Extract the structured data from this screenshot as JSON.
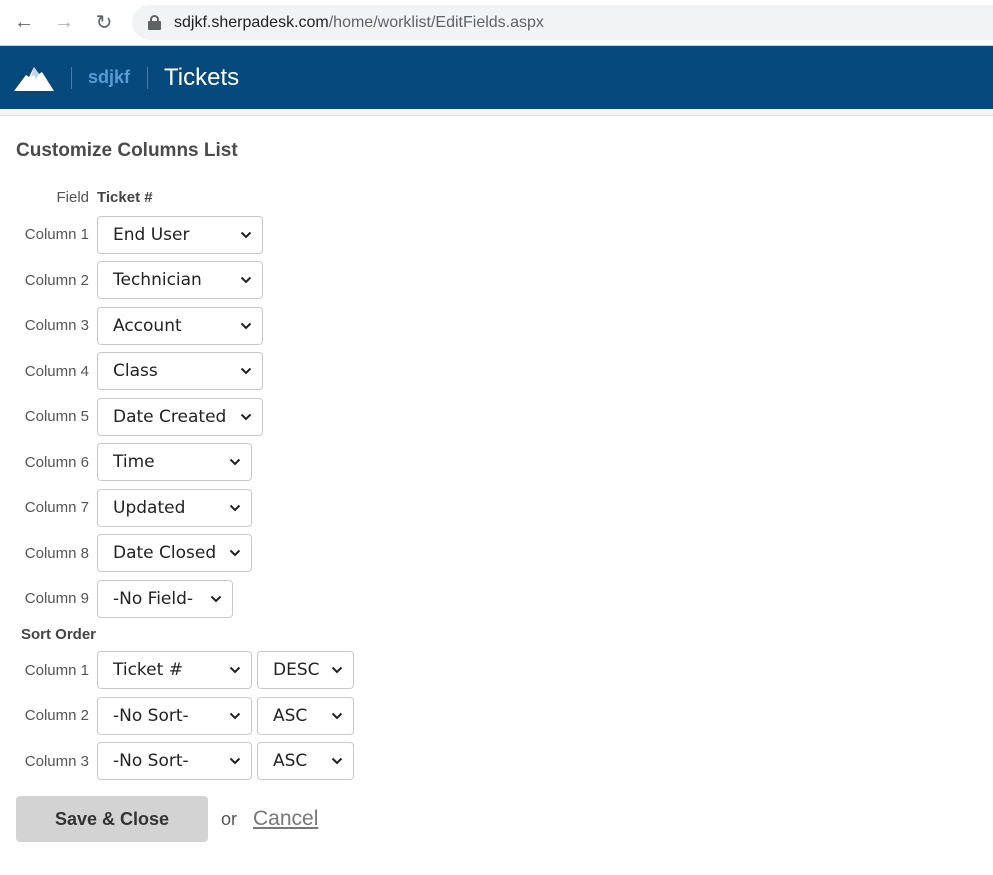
{
  "browser": {
    "url_host": "sdjkf.sherpadesk.com",
    "url_path": "/home/worklist/EditFields.aspx"
  },
  "header": {
    "org": "sdjkf",
    "title": "Tickets"
  },
  "page": {
    "title": "Customize Columns List",
    "field_label": "Field",
    "field_value": "Ticket #"
  },
  "columns": [
    {
      "label": "Column 1",
      "value": "End User"
    },
    {
      "label": "Column 2",
      "value": "Technician"
    },
    {
      "label": "Column 3",
      "value": "Account"
    },
    {
      "label": "Column 4",
      "value": "Class"
    },
    {
      "label": "Column 5",
      "value": "Date Created"
    },
    {
      "label": "Column 6",
      "value": "Time"
    },
    {
      "label": "Column 7",
      "value": "Updated"
    },
    {
      "label": "Column 8",
      "value": "Date Closed"
    },
    {
      "label": "Column 9",
      "value": "-No Field-"
    }
  ],
  "sort": {
    "title": "Sort Order",
    "rows": [
      {
        "label": "Column 1",
        "field": "Ticket #",
        "direction": "DESC"
      },
      {
        "label": "Column 2",
        "field": "-No Sort-",
        "direction": "ASC"
      },
      {
        "label": "Column 3",
        "field": "-No Sort-",
        "direction": "ASC"
      }
    ]
  },
  "actions": {
    "save_label": "Save & Close",
    "or_text": "or",
    "cancel_label": "Cancel"
  },
  "colors": {
    "header_bg": "#06497c",
    "org_text": "#5b9bd5",
    "save_bg": "#d3d3d3"
  }
}
